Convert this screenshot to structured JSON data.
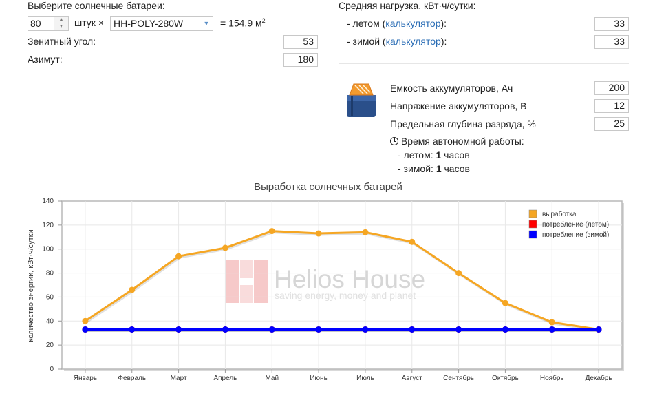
{
  "panels": {
    "select_label": "Выберите солнечные батареи:",
    "count": "80",
    "count_unit": "штук ×",
    "model": "HH-POLY-280W",
    "area_prefix": "= 154.9 м",
    "area_sup": "2",
    "zenith_label": "Зенитный угол:",
    "zenith_value": "53",
    "azimuth_label": "Азимут:",
    "azimuth_value": "180"
  },
  "load": {
    "title": "Средняя нагрузка, кВт·ч/сутки:",
    "summer_prefix": "- летом (",
    "summer_link": "калькулятор",
    "summer_suffix": "):",
    "summer_value": "33",
    "winter_prefix": "- зимой (",
    "winter_link": "калькулятор",
    "winter_suffix": "):",
    "winter_value": "33"
  },
  "battery": {
    "icon": "battery-icon",
    "capacity_label": "Емкость аккумуляторов, Ач",
    "capacity_value": "200",
    "voltage_label": "Напряжение аккумуляторов, В",
    "voltage_value": "12",
    "depth_label": "Предельная глубина разряда, %",
    "depth_value": "25",
    "autonomy_title": "Время автономной работы:",
    "summer_prefix": "- летом: ",
    "summer_hours": "1",
    "summer_unit": " часов",
    "winter_prefix": "- зимой: ",
    "winter_hours": "1",
    "winter_unit": " часов"
  },
  "watermark": {
    "name": "Helios House",
    "tagline": "saving energy, money and planet"
  },
  "chart_data": {
    "type": "line",
    "title": "Выработка солнечных батарей",
    "ylabel": "количество энергии, кВт·ч/сутки",
    "xlabel": "",
    "ylim": [
      0,
      140
    ],
    "yticks": [
      0,
      20,
      40,
      60,
      80,
      100,
      120,
      140
    ],
    "grid": true,
    "legend_position": "top-right",
    "categories": [
      "Январь",
      "Февраль",
      "Март",
      "Апрель",
      "Май",
      "Июнь",
      "Июль",
      "Август",
      "Сентябрь",
      "Октябрь",
      "Ноябрь",
      "Декабрь"
    ],
    "series": [
      {
        "name": "выработка",
        "color": "#f5a623",
        "values": [
          40,
          66,
          94,
          101,
          115,
          113,
          114,
          106,
          80,
          55,
          39,
          33
        ]
      },
      {
        "name": "потребление (летом)",
        "color": "#ff0000",
        "values": [
          33,
          33,
          33,
          33,
          33,
          33,
          33,
          33,
          33,
          33,
          33,
          33
        ]
      },
      {
        "name": "потребление (зимой)",
        "color": "#0000ff",
        "values": [
          33,
          33,
          33,
          33,
          33,
          33,
          33,
          33,
          33,
          33,
          33,
          33
        ]
      }
    ]
  }
}
